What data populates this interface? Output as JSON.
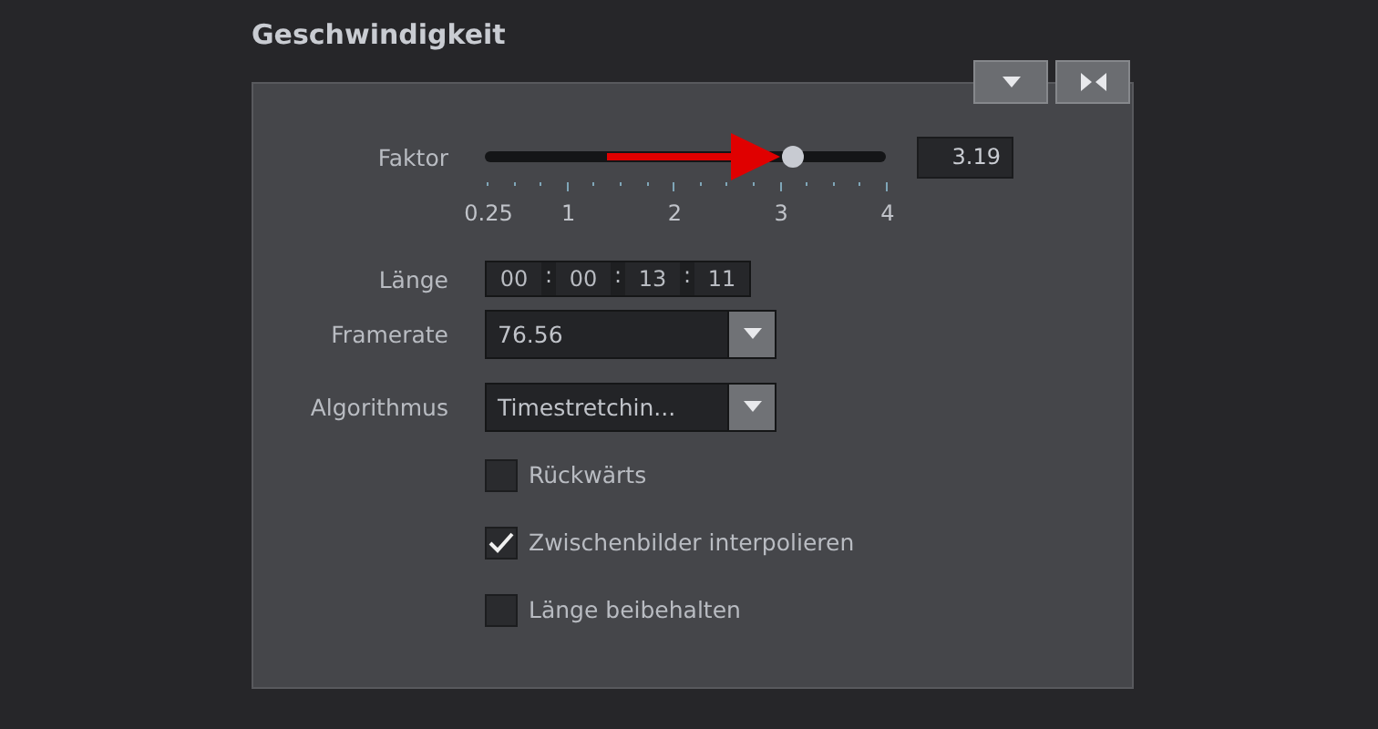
{
  "title": "Geschwindigkeit",
  "header_buttons": [
    {
      "kind": "dropdown"
    },
    {
      "kind": "collapse"
    }
  ],
  "factor": {
    "label": "Faktor",
    "level": 0.77,
    "value": "3.19",
    "tick_labels": [
      "0.25",
      "1",
      "2",
      "3",
      "4"
    ]
  },
  "length": {
    "label": "Länge",
    "parts": [
      "00",
      "00",
      "13",
      "11"
    ],
    "separator": ":"
  },
  "framerate": {
    "label": "Framerate",
    "value": "76.56"
  },
  "algorithm": {
    "label": "Algorithmus",
    "value": "Timestretchin..."
  },
  "options": [
    {
      "label": "Rückwärts",
      "checked": false
    },
    {
      "label": "Zwischenbilder interpolieren",
      "checked": true
    },
    {
      "label": "Länge beibehalten",
      "checked": false
    }
  ]
}
